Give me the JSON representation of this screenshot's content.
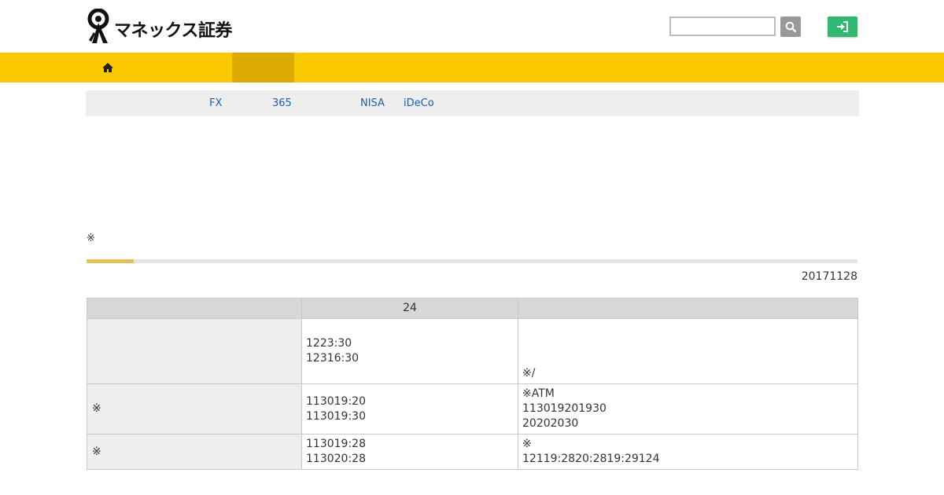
{
  "brand": {
    "logo_text": "マネックス証券"
  },
  "search": {
    "placeholder": ""
  },
  "subnav": {
    "items": [
      "FX",
      "365",
      "NISA",
      "iDeCo"
    ]
  },
  "notice": {
    "mark": "※"
  },
  "content": {
    "date": "20171128",
    "table": {
      "headers": [
        "",
        "24",
        ""
      ],
      "rows": [
        {
          "label": "",
          "times": [
            "1223:30",
            "12316:30"
          ],
          "notes": [
            "※/"
          ]
        },
        {
          "label": "※",
          "times": [
            "113019:20",
            "113019:30"
          ],
          "notes": [
            "※ATM",
            "113019201930",
            "20202030"
          ]
        },
        {
          "label": "※",
          "times": [
            "113019:28",
            "113020:28"
          ],
          "notes": [
            "※",
            "12119:2820:2819:29124"
          ]
        }
      ]
    }
  },
  "colors": {
    "nav_bar": "#fcc800",
    "nav_active": "#dcaa00",
    "login_button": "#2eb872",
    "search_button": "#999999",
    "link": "#1b5fb5"
  },
  "icons": {
    "home": "home-icon",
    "search": "magnifier-icon",
    "login": "sign-in-icon"
  }
}
